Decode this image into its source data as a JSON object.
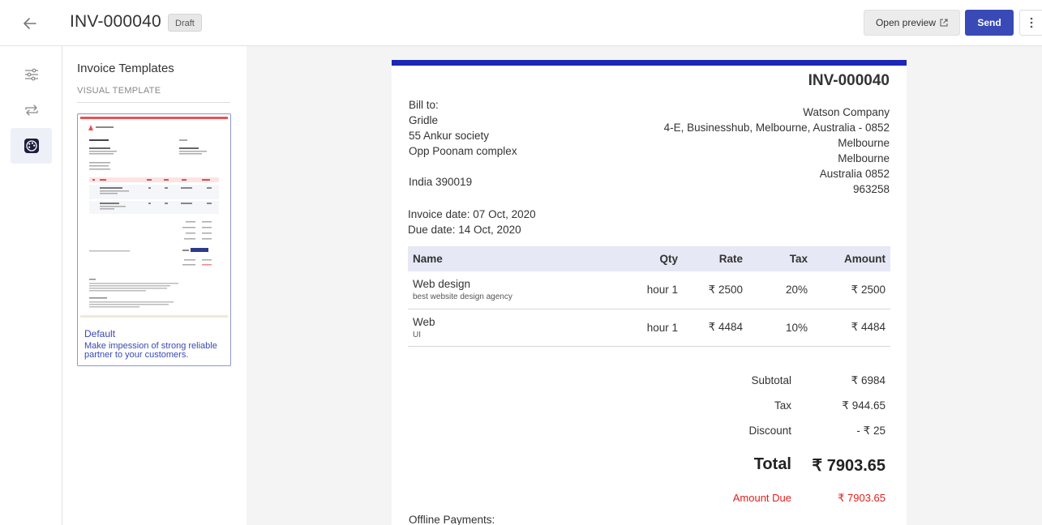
{
  "header": {
    "title": "INV-000040",
    "status_badge": "Draft",
    "open_preview_label": "Open preview",
    "send_label": "Send"
  },
  "rail": {
    "items": [
      {
        "icon": "sliders-icon"
      },
      {
        "icon": "repeat-icon"
      },
      {
        "icon": "palette-icon",
        "active": true
      }
    ]
  },
  "templates_panel": {
    "title": "Invoice Templates",
    "subtitle": "VISUAL TEMPLATE",
    "templates": [
      {
        "name": "Default",
        "description": "Make impession of strong reliable partner to your customers."
      }
    ]
  },
  "invoice": {
    "number": "INV-000040",
    "accent_color": "#1a27b7",
    "bill_to": {
      "label": "Bill to:",
      "lines": [
        "Gridle",
        "55 Ankur society",
        "Opp Poonam complex",
        "",
        "India 390019"
      ]
    },
    "company": {
      "lines": [
        "Watson Company",
        "4-E, Businesshub, Melbourne, Australia - 0852",
        "Melbourne",
        "Melbourne",
        "Australia 0852",
        "963258"
      ]
    },
    "invoice_date": "Invoice date: 07 Oct, 2020",
    "due_date": "Due date: 14 Oct, 2020",
    "columns": [
      "Name",
      "Qty",
      "Rate",
      "Tax",
      "Amount"
    ],
    "items": [
      {
        "name": "Web design",
        "description": "best website design agency",
        "qty": "hour 1",
        "rate": "₹ 2500",
        "tax": "20%",
        "amount": "₹ 2500"
      },
      {
        "name": "Web",
        "description": "UI",
        "qty": "hour 1",
        "rate": "₹ 4484",
        "tax": "10%",
        "amount": "₹ 4484"
      }
    ],
    "totals": {
      "subtotal_label": "Subtotal",
      "subtotal": "₹ 6984",
      "tax_label": "Tax",
      "tax": "₹ 944.65",
      "discount_label": "Discount",
      "discount": "- ₹ 25",
      "total_label": "Total",
      "total": "₹ 7903.65",
      "amount_due_label": "Amount Due",
      "amount_due": "₹ 7903.65",
      "amount_due_color": "#e0201b"
    },
    "offline_payments_label": "Offline Payments:"
  }
}
